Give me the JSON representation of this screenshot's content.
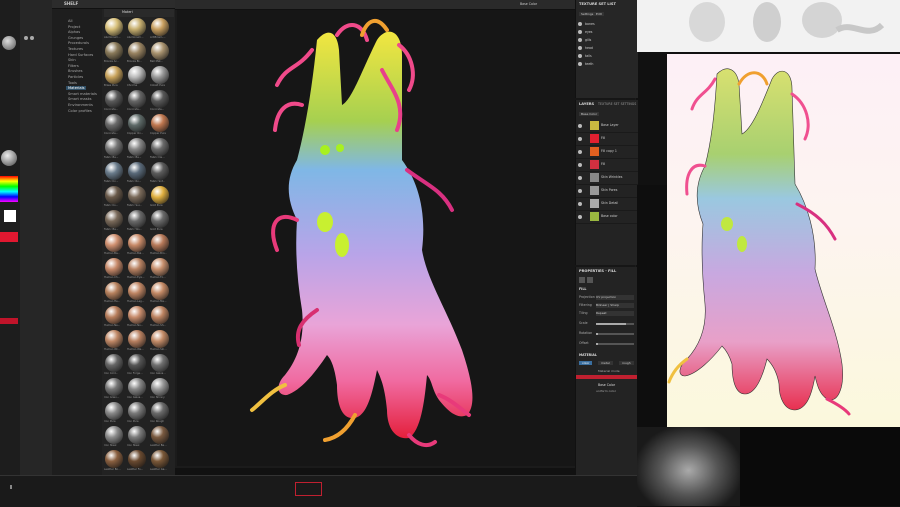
{
  "shelf": {
    "title": "SHELF",
    "categories": [
      "All",
      "Project",
      "Alphas",
      "Grunges",
      "Procedurals",
      "Textures",
      "Hard Surfaces",
      "Skin",
      "Filters",
      "Brushes",
      "Particles",
      "Tools",
      "Materials",
      "Smart materials",
      "Smart masks",
      "Environments",
      "Color profiles"
    ],
    "active_category": "Materials",
    "tool_label": "Materi",
    "materials": [
      {
        "label": "Aluminium...",
        "color": "#d8c07a"
      },
      {
        "label": "Aluminium...",
        "color": "#c8b070"
      },
      {
        "label": "Artificial L...",
        "color": "#c9a060"
      },
      {
        "label": "Bronze Ar...",
        "color": "#8a7a5a"
      },
      {
        "label": "Bronze Bl...",
        "color": "#9a8462"
      },
      {
        "label": "Ball Mat...",
        "color": "#aa9470"
      },
      {
        "label": "Brass Pure",
        "color": "#caa45c"
      },
      {
        "label": "Chrome",
        "color": "#bbbbbb"
      },
      {
        "label": "Cobalt Pure",
        "color": "#9a9a9a"
      },
      {
        "label": "Concrete...",
        "color": "#5a5a5a"
      },
      {
        "label": "Concrete...",
        "color": "#666666"
      },
      {
        "label": "Concrete...",
        "color": "#585858"
      },
      {
        "label": "Concrete...",
        "color": "#6a6a6a"
      },
      {
        "label": "Copper Ox...",
        "color": "#5e6a68"
      },
      {
        "label": "Copper Pure",
        "color": "#c07850"
      },
      {
        "label": "Fabric Ba...",
        "color": "#777777"
      },
      {
        "label": "Fabric Ba...",
        "color": "#888888"
      },
      {
        "label": "Fabric De...",
        "color": "#6a6a6a"
      },
      {
        "label": "Fabric Kn...",
        "color": "#6a7c8c"
      },
      {
        "label": "Fabric Ro...",
        "color": "#5a6a7a"
      },
      {
        "label": "Fabric Sof...",
        "color": "#5c5c5c"
      },
      {
        "label": "Fabric Ko...",
        "color": "#6a5a4a"
      },
      {
        "label": "Fabric Sui...",
        "color": "#7a6a5a"
      },
      {
        "label": "Gold Pure",
        "color": "#e0b040"
      },
      {
        "label": "Fabric Ba...",
        "color": "#7a6a5a"
      },
      {
        "label": "Fabric Wo...",
        "color": "#6a6a6a"
      },
      {
        "label": "Gold Pure",
        "color": "#6a6a6a"
      },
      {
        "label": "Human Ba...",
        "color": "#d09070"
      },
      {
        "label": "Human Bal...",
        "color": "#c88a68"
      },
      {
        "label": "Human Bro...",
        "color": "#b87a5a"
      },
      {
        "label": "Human Ch...",
        "color": "#c88a6a"
      },
      {
        "label": "Human Eye...",
        "color": "#b88262"
      },
      {
        "label": "Human Fo...",
        "color": "#c8906e"
      },
      {
        "label": "Human He...",
        "color": "#b8825e"
      },
      {
        "label": "Human Leg...",
        "color": "#c08664"
      },
      {
        "label": "Human Ma...",
        "color": "#c48a66"
      },
      {
        "label": "Human Ne...",
        "color": "#b87e5c"
      },
      {
        "label": "Human No...",
        "color": "#c88c6c"
      },
      {
        "label": "Human Sh...",
        "color": "#be8462"
      },
      {
        "label": "Human Wr...",
        "color": "#c08866"
      },
      {
        "label": "Human We...",
        "color": "#b88060"
      },
      {
        "label": "Human Ski...",
        "color": "#c48c68"
      },
      {
        "label": "Iron Cold...",
        "color": "#666666"
      },
      {
        "label": "Iron Forge...",
        "color": "#555555"
      },
      {
        "label": "Iron Galva...",
        "color": "#707070"
      },
      {
        "label": "Iron Grain...",
        "color": "#777777"
      },
      {
        "label": "Iron Galva...",
        "color": "#888888"
      },
      {
        "label": "Iron Shinny",
        "color": "#999999"
      },
      {
        "label": "Iron Pure",
        "color": "#8a8a8a"
      },
      {
        "label": "Iron Pure",
        "color": "#7a7a7a"
      },
      {
        "label": "Iron Rough",
        "color": "#6a6a6a"
      },
      {
        "label": "Iron Steel",
        "color": "#8c8c8c"
      },
      {
        "label": "Iron Steel",
        "color": "#7c7c7c"
      },
      {
        "label": "Leather Ba...",
        "color": "#7a5a40"
      },
      {
        "label": "Leather Bo...",
        "color": "#8a6040"
      },
      {
        "label": "Leather Fo...",
        "color": "#6a4a30"
      },
      {
        "label": "Leather Ga...",
        "color": "#7a5838"
      }
    ]
  },
  "viewport": {
    "mode_label": "Base Color",
    "artwork_desc": "monster"
  },
  "texture_set_list": {
    "title": "TEXTURE SET LIST",
    "tabs": [
      "Settings",
      "Edit"
    ],
    "items": [
      "bones",
      "eyes",
      "gills",
      "head",
      "tails",
      "teeth"
    ]
  },
  "layers": {
    "title": "LAYERS",
    "tab2": "TEXTURE SET SETTINGS",
    "channel": "Base Color",
    "items": [
      {
        "name": "Base Layer",
        "thumb": "#c8b840"
      },
      {
        "name": "Fill",
        "thumb": "#e02030"
      },
      {
        "name": "Fill copy 1",
        "thumb": "#e06020"
      },
      {
        "name": "Fill",
        "thumb": "#d03040"
      },
      {
        "name": "Skin Wrinkles",
        "thumb": "#888888"
      },
      {
        "name": "Skin Pores",
        "thumb": "#999999"
      },
      {
        "name": "Skin Detail",
        "thumb": "#aaaaaa"
      },
      {
        "name": "Base color",
        "thumb": "#9ab840"
      }
    ]
  },
  "properties": {
    "title": "PROPERTIES - FILL",
    "section_fill": "FILL",
    "projection_label": "Projection",
    "projection_value": "UV projection",
    "filtering_label": "Filtering",
    "filtering_value": "Bilinear | Sharp",
    "tiling_label": "Tiling",
    "tiling_value": "Repeat",
    "scale_label": "Scale",
    "rotation_label": "Rotation",
    "offset_label": "Offset",
    "material_title": "MATERIAL",
    "material_modes": [
      "color",
      "metal",
      "rough"
    ],
    "material_mode_note": "Material mode",
    "base_color_label": "Base Color",
    "base_color_value": "uniform color",
    "accent": "#3a6fa0",
    "red_bar": "#c02030"
  }
}
